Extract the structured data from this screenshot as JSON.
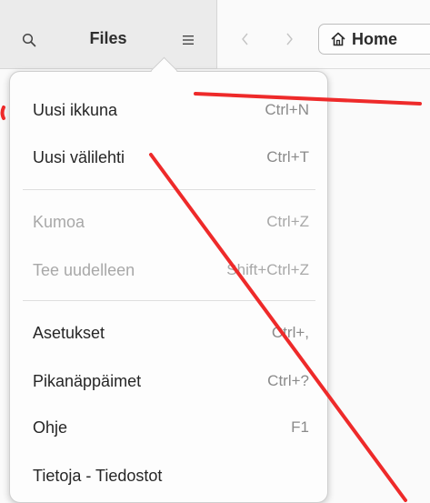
{
  "header": {
    "title": "Files",
    "search_icon": "search-icon",
    "menu_icon": "hamburger-menu-icon",
    "back_icon": "chevron-left-icon",
    "forward_icon": "chevron-right-icon",
    "path": {
      "icon": "home-icon",
      "label": "Home"
    }
  },
  "menu": {
    "groups": [
      [
        {
          "label": "Uusi ikkuna",
          "shortcut": "Ctrl+N",
          "enabled": true
        },
        {
          "label": "Uusi välilehti",
          "shortcut": "Ctrl+T",
          "enabled": true
        }
      ],
      [
        {
          "label": "Kumoa",
          "shortcut": "Ctrl+Z",
          "enabled": false
        },
        {
          "label": "Tee uudelleen",
          "shortcut": "Shift+Ctrl+Z",
          "enabled": false
        }
      ],
      [
        {
          "label": "Asetukset",
          "shortcut": "Ctrl+,",
          "enabled": true
        },
        {
          "label": "Pikanäppäimet",
          "shortcut": "Ctrl+?",
          "enabled": true
        },
        {
          "label": "Ohje",
          "shortcut": "F1",
          "enabled": true
        },
        {
          "label": "Tietoja - Tiedostot",
          "shortcut": "",
          "enabled": true
        }
      ]
    ]
  },
  "colors": {
    "annotation": "#ee2a2a",
    "menu_bg": "#fdfdfd",
    "sidebar_header_bg": "#ebebeb",
    "disabled_text": "#a8a8a8"
  }
}
